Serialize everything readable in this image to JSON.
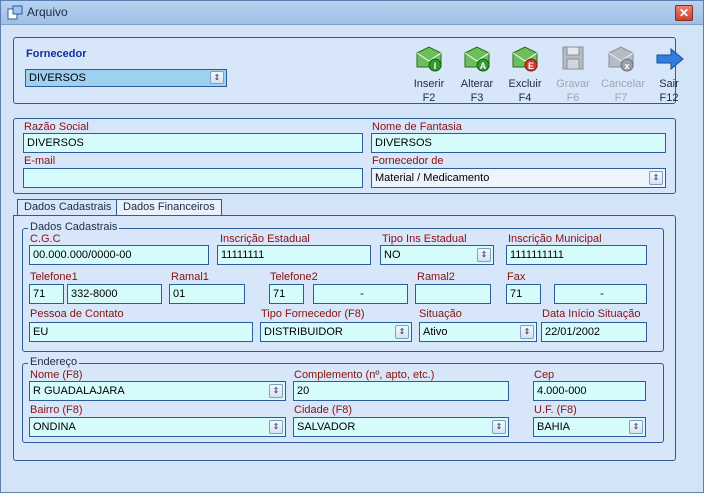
{
  "window": {
    "title": "Arquivo"
  },
  "fornecedor": {
    "label": "Fornecedor",
    "value": "DIVERSOS"
  },
  "toolbar": [
    {
      "label": "Inserir",
      "key": "F2",
      "icon": "insert-icon",
      "enabled": true
    },
    {
      "label": "Alterar",
      "key": "F3",
      "icon": "edit-icon",
      "enabled": true
    },
    {
      "label": "Excluir",
      "key": "F4",
      "icon": "delete-icon",
      "enabled": true
    },
    {
      "label": "Gravar",
      "key": "F6",
      "icon": "save-icon",
      "enabled": false
    },
    {
      "label": "Cancelar",
      "key": "F7",
      "icon": "cancel-icon",
      "enabled": false
    },
    {
      "label": "Sair",
      "key": "F12",
      "icon": "exit-arrow-icon",
      "enabled": true
    }
  ],
  "general": {
    "razao_label": "Razão Social",
    "razao_value": "DIVERSOS",
    "fantasia_label": "Nome de Fantasia",
    "fantasia_value": "DIVERSOS",
    "email_label": "E-mail",
    "email_value": "",
    "fornecedor_de_label": "Fornecedor de",
    "fornecedor_de_value": "Material / Medicamento"
  },
  "tabs": [
    {
      "label": "Dados Cadastrais",
      "active": true
    },
    {
      "label": "Dados Financeiros",
      "active": false
    }
  ],
  "cadastrais": {
    "group_title": "Dados Cadastrais",
    "cgc_label": "C.G.C",
    "cgc_value": "00.000.000/0000-00",
    "ie_label": "Inscrição Estadual",
    "ie_value": "11111111",
    "tipo_ins_label": "Tipo Ins Estadual",
    "tipo_ins_value": "NO",
    "im_label": "Inscrição Municipal",
    "im_value": "1111111111",
    "tel1_label": "Telefone1",
    "tel1_ddd": "71",
    "tel1_num": "332-8000",
    "ramal1_label": "Ramal1",
    "ramal1_value": "01",
    "tel2_label": "Telefone2",
    "tel2_ddd": "71",
    "tel2_num": "-",
    "ramal2_label": "Ramal2",
    "ramal2_value": "",
    "fax_label": "Fax",
    "fax_ddd": "71",
    "fax_num": "-",
    "contato_label": "Pessoa de Contato",
    "contato_value": "EU",
    "tipo_forn_label": "Tipo Fornecedor (F8)",
    "tipo_forn_value": "DISTRIBUIDOR",
    "situacao_label": "Situação",
    "situacao_value": "Ativo",
    "data_label": "Data Início Situação",
    "data_value": "22/01/2002"
  },
  "endereco": {
    "group_title": "Endereço",
    "nome_label": "Nome (F8)",
    "nome_value": "R GUADALAJARA",
    "compl_label": "Complemento (nº, apto, etc.)",
    "compl_value": "20",
    "cep_label": "Cep",
    "cep_value": "4.000-000",
    "bairro_label": "Bairro (F8)",
    "bairro_value": "ONDINA",
    "cidade_label": "Cidade (F8)",
    "cidade_value": "SALVADOR",
    "uf_label": "U.F. (F8)",
    "uf_value": "BAHIA"
  }
}
